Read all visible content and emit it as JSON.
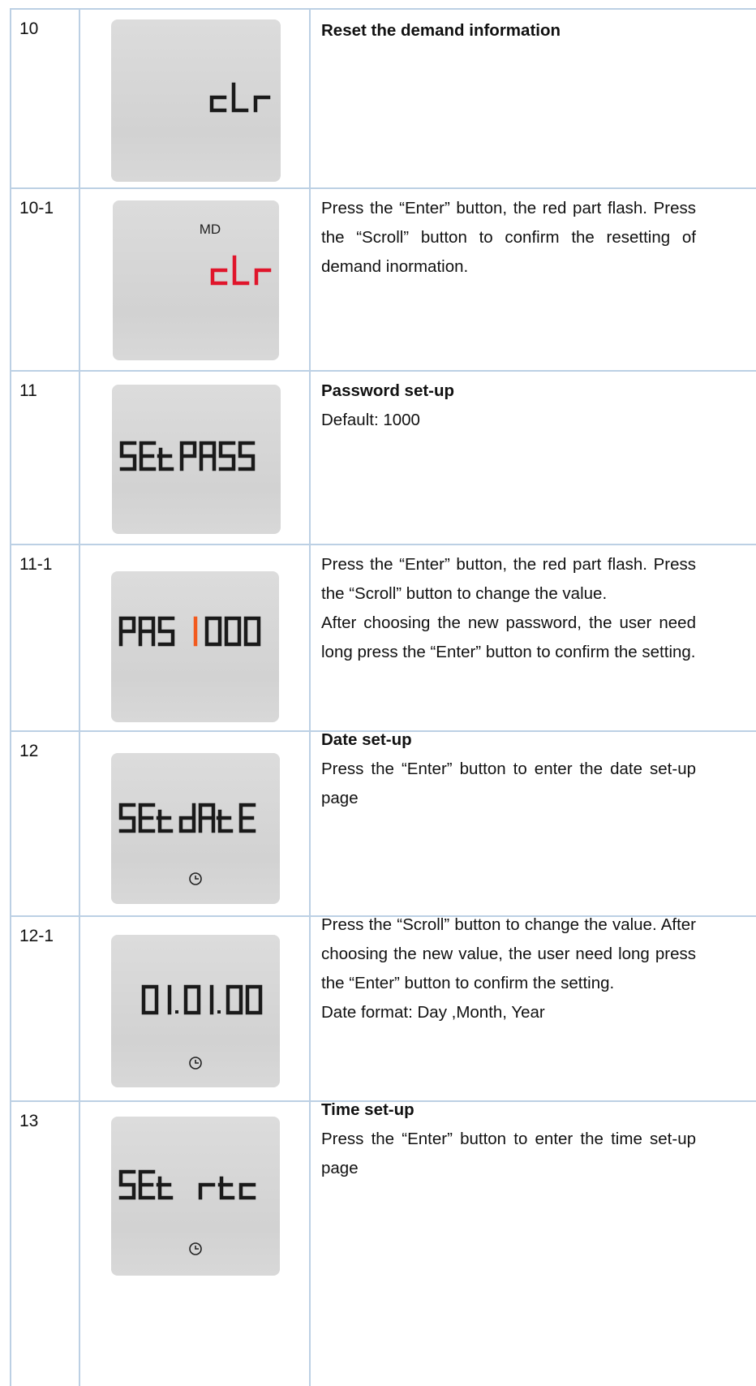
{
  "rows": [
    {
      "number": "10",
      "lcd": {
        "main": "cLr",
        "highlight": false
      },
      "title": "Reset the demand information",
      "lines": []
    },
    {
      "number": "10-1",
      "lcd": {
        "label": "MD",
        "main": "cLr",
        "highlight": true
      },
      "title": "",
      "lines": [
        "Press the “Enter” button, the red part flash. Press the “Scroll” button to confirm the resetting of demand inormation."
      ]
    },
    {
      "number": "11",
      "lcd": {
        "main": "SEtPASS",
        "highlight": false
      },
      "title": "Password set-up",
      "lines": [
        "Default: 1000"
      ]
    },
    {
      "number": "11-1",
      "lcd": {
        "main": "PAS 1000",
        "highlight": "1"
      },
      "title": "",
      "lines": [
        "Press the “Enter” button, the red part flash. Press the “Scroll” button to change the value.",
        "After choosing the new password, the user need long press the “Enter” button to confirm the setting."
      ]
    },
    {
      "number": "12",
      "lcd": {
        "main": "SEtdAtE",
        "highlight": false,
        "icon": "clock-icon"
      },
      "title": "Date set-up",
      "lines": [
        "Press the “Enter” button to enter the date set-up page"
      ]
    },
    {
      "number": "12-1",
      "lcd": {
        "main": "01.01.00",
        "highlight": false,
        "icon": "clock-icon"
      },
      "title": "",
      "lines": [
        "Press the “Scroll” button to change the value. After choosing the new value, the user need long press the “Enter” button to confirm the setting.",
        "Date format: Day ,Month, Year"
      ]
    },
    {
      "number": "13",
      "lcd": {
        "main": "SEt rtc",
        "highlight": false,
        "icon": "clock-icon"
      },
      "title": "Time set-up",
      "lines": [
        "Press the “Enter” button to enter the time set-up page"
      ]
    }
  ],
  "colors": {
    "highlight_red": "#e0152b",
    "highlight_orange": "#f25a1e",
    "segment": "#1a1a1a",
    "border": "#bcd0e4"
  }
}
